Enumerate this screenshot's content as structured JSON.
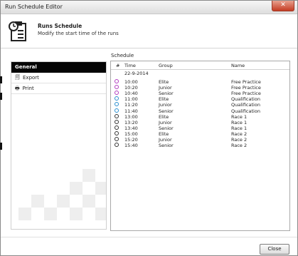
{
  "window": {
    "title": "Run Schedule Editor"
  },
  "header": {
    "title": "Runs Schedule",
    "subtitle": "Modify the start time of the runs"
  },
  "sidebar": {
    "header": "General",
    "items": [
      {
        "label": "Export",
        "icon": "export-icon"
      },
      {
        "label": "Print",
        "icon": "printer-icon"
      }
    ]
  },
  "schedule": {
    "label": "Schedule",
    "columns": {
      "num": "#",
      "time": "Time",
      "group": "Group",
      "name": "Name"
    },
    "date": "22-9-2014",
    "rows": [
      {
        "time": "10:00",
        "group": "Elite",
        "name": "Free Practice",
        "color": "#b23cc0"
      },
      {
        "time": "10:20",
        "group": "Junior",
        "name": "Free Practice",
        "color": "#b23cc0"
      },
      {
        "time": "10:40",
        "group": "Senior",
        "name": "Free Practice",
        "color": "#b23cc0"
      },
      {
        "time": "11:00",
        "group": "Elite",
        "name": "Qualification",
        "color": "#2a8fd0"
      },
      {
        "time": "11:20",
        "group": "Junior",
        "name": "Qualification",
        "color": "#2a8fd0"
      },
      {
        "time": "11:40",
        "group": "Senior",
        "name": "Qualification",
        "color": "#2a8fd0"
      },
      {
        "time": "13:00",
        "group": "Elite",
        "name": "Race 1",
        "color": "#333333"
      },
      {
        "time": "13:20",
        "group": "Junior",
        "name": "Race 1",
        "color": "#333333"
      },
      {
        "time": "13:40",
        "group": "Senior",
        "name": "Race 1",
        "color": "#333333"
      },
      {
        "time": "15:00",
        "group": "Elite",
        "name": "Race 2",
        "color": "#333333"
      },
      {
        "time": "15:20",
        "group": "Junior",
        "name": "Race 2",
        "color": "#333333"
      },
      {
        "time": "15:40",
        "group": "Senior",
        "name": "Race 2",
        "color": "#333333"
      }
    ]
  },
  "footer": {
    "close_label": "Close"
  }
}
